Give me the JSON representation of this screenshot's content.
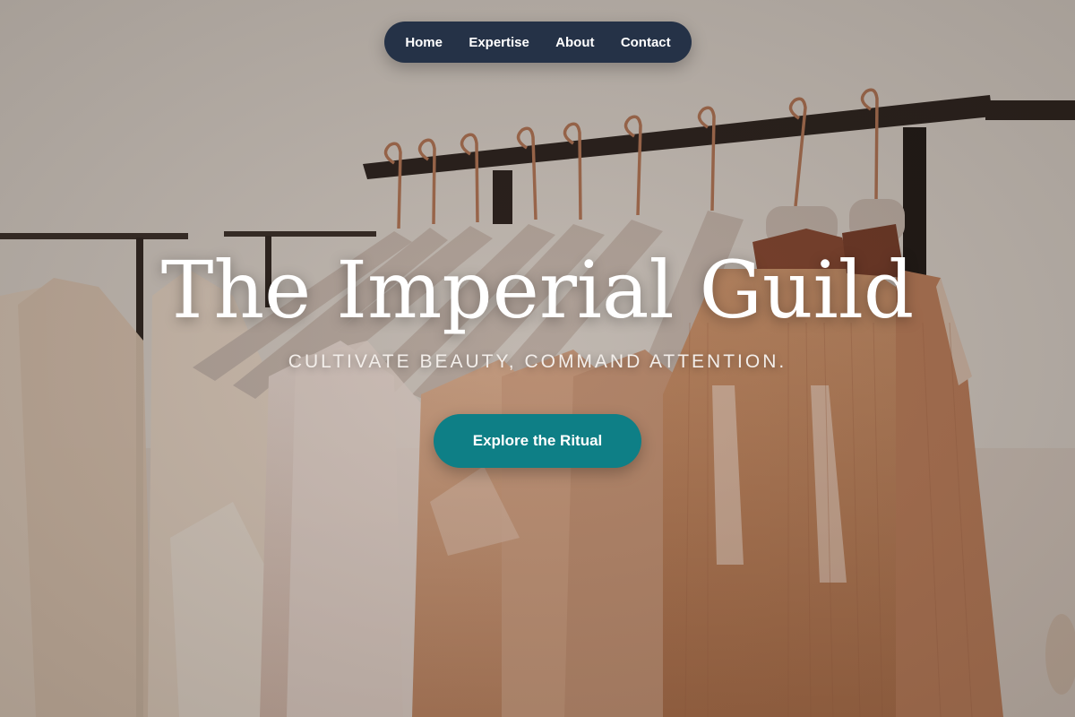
{
  "nav": {
    "items": [
      {
        "label": "Home"
      },
      {
        "label": "Expertise"
      },
      {
        "label": "About"
      },
      {
        "label": "Contact"
      }
    ]
  },
  "hero": {
    "title": "The Imperial Guild",
    "tagline": "CULTIVATE BEAUTY, COMMAND ATTENTION.",
    "cta_label": "Explore the Ritual",
    "background_description": "clothing rack with dresses on velvet hangers"
  },
  "colors": {
    "nav_bg": "#253247",
    "cta_bg": "#0e7f86",
    "text": "#ffffff"
  }
}
